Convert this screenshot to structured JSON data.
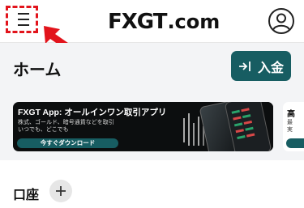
{
  "header": {
    "logo_main": "FXGT",
    "logo_suffix": ".com",
    "menu_icon": "hamburger-menu-icon",
    "user_icon": "user-avatar-icon",
    "annotation_color": "#e2141c"
  },
  "main": {
    "title": "ホーム",
    "deposit_label": "入金",
    "deposit_icon": "arrow-into-bar-icon",
    "accent_color": "#175d62"
  },
  "banners": [
    {
      "title": "FXGT App: オールインワン取引アプリ",
      "subtitle_line1": "株式、ゴールド、暗号通貨などを取引",
      "subtitle_line2": "いつでも、どこでも",
      "cta": "今すぐダウンロード"
    },
    {
      "title": "高",
      "subtitle_line1": "最",
      "subtitle_line2": "実"
    }
  ],
  "accounts": {
    "title": "口座",
    "add_icon": "plus-icon"
  }
}
